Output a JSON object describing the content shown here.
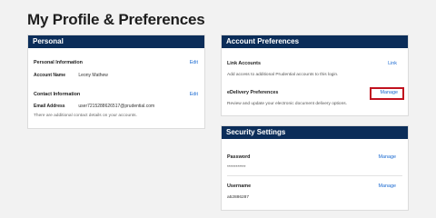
{
  "page": {
    "title": "My Profile & Preferences"
  },
  "personal": {
    "header": "Personal",
    "info": {
      "title": "Personal Information",
      "edit": "Edit",
      "account_name_label": "Account Name",
      "account_name_value": "Leony Mathew"
    },
    "contact": {
      "title": "Contact Information",
      "edit": "Edit",
      "email_label": "Email Address",
      "email_value": "user7215288626517@prudential.com",
      "note": "There are additional contact details on your accounts."
    }
  },
  "account_prefs": {
    "header": "Account Preferences",
    "link_accounts": {
      "title": "Link Accounts",
      "action": "Link",
      "desc": "Add access to additional Prudential accounts to this login."
    },
    "edelivery": {
      "title": "eDelivery Preferences",
      "action": "Manage",
      "desc": "Review and update your electronic document delivery options."
    }
  },
  "security": {
    "header": "Security Settings",
    "password": {
      "title": "Password",
      "action": "Manage",
      "value": "***********"
    },
    "username": {
      "title": "Username",
      "action": "Manage",
      "value": "a52886287"
    }
  },
  "colors": {
    "header_bg": "#0b2d59",
    "link": "#1a6ad1",
    "highlight": "#c1121f"
  }
}
